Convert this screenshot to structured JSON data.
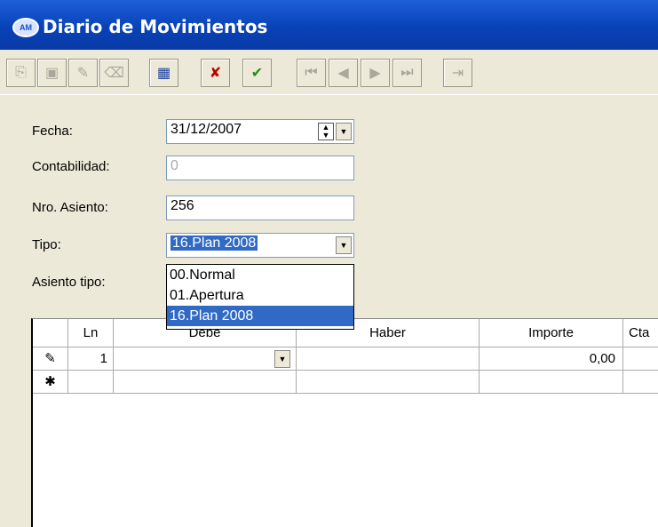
{
  "window": {
    "logo_text": "AM",
    "title": "Diario de Movimientos"
  },
  "toolbar": {
    "buttons": [
      {
        "name": "new-icon",
        "glyph": "⎘",
        "enabled": false
      },
      {
        "name": "edit-icon",
        "glyph": "▣",
        "enabled": false
      },
      {
        "name": "copy-icon",
        "glyph": "✎",
        "enabled": false
      },
      {
        "name": "delete-icon",
        "glyph": "⌫",
        "enabled": false
      },
      {
        "name": "grid-icon",
        "glyph": "▦",
        "enabled": true
      },
      {
        "name": "cancel-icon",
        "glyph": "✘",
        "enabled": true
      },
      {
        "name": "confirm-icon",
        "glyph": "✔",
        "enabled": true
      },
      {
        "name": "first-icon",
        "glyph": "⏮",
        "enabled": false
      },
      {
        "name": "prev-icon",
        "glyph": "◀",
        "enabled": false
      },
      {
        "name": "next-icon",
        "glyph": "▶",
        "enabled": false
      },
      {
        "name": "last-icon",
        "glyph": "⏭",
        "enabled": false
      },
      {
        "name": "exit-icon",
        "glyph": "⇥",
        "enabled": false
      }
    ]
  },
  "form": {
    "fecha_label": "Fecha:",
    "fecha_value": "31/12/2007",
    "contabilidad_label": "Contabilidad:",
    "contabilidad_value": "0",
    "asiento_label": "Nro. Asiento:",
    "asiento_value": "256",
    "tipo_label": "Tipo:",
    "tipo_value": "16.Plan 2008",
    "asiento_tipo_label": "Asiento tipo:"
  },
  "tipo_options": [
    "00.Normal",
    "01.Apertura",
    "16.Plan 2008"
  ],
  "grid": {
    "headers": {
      "ln": "Ln",
      "debe": "Debe",
      "haber": "Haber",
      "importe": "Importe",
      "cta": "Cta"
    },
    "rows": [
      {
        "indicator": "✎",
        "ln": "1",
        "debe": "",
        "haber": "",
        "importe": "0,00"
      }
    ],
    "new_row_indicator": "✱"
  },
  "colors": {
    "title_bar": "#0842b8",
    "selection": "#316ac5",
    "chrome": "#ece9d8"
  }
}
